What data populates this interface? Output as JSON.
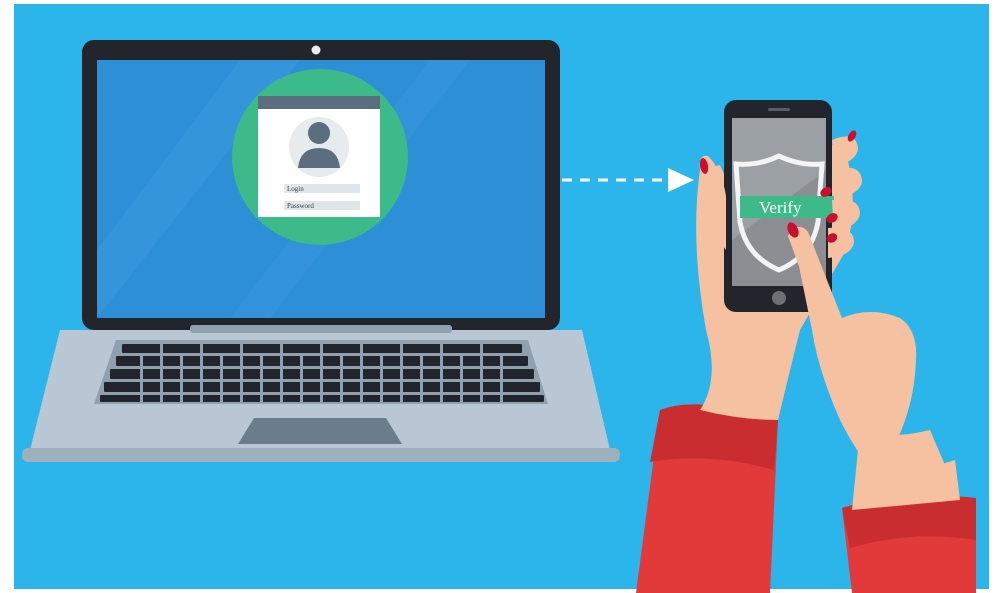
{
  "login_card": {
    "login_label": "Login",
    "password_label": "Password"
  },
  "phone": {
    "verify_label": "Verify"
  },
  "icons": {
    "avatar": "user-avatar-icon",
    "shield": "shield-icon",
    "arrow": "dashed-arrow-icon",
    "home_button": "home-button-icon"
  },
  "colors": {
    "background": "#2bb5ea",
    "laptop_body": "#b8c7d3",
    "laptop_screen": "#2d8fd6",
    "login_circle": "#3dba8a",
    "verify_bar": "#3dba8a",
    "sleeve": "#e23a3a",
    "skin": "#f5c1a0",
    "nails": "#c8102e"
  }
}
